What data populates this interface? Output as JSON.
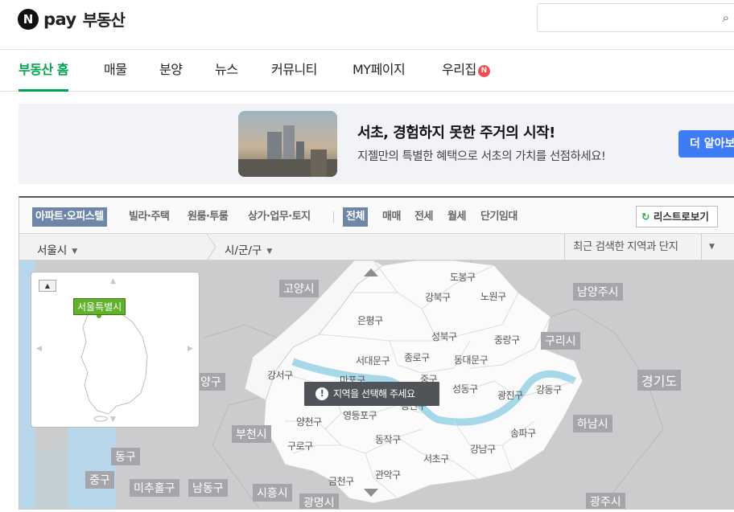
{
  "header": {
    "logo_n": "N",
    "logo_pay": "pay",
    "logo_title": "부동산",
    "search_placeholder": ""
  },
  "nav": {
    "tabs": [
      "부동산 홈",
      "매물",
      "분양",
      "뉴스",
      "커뮤니티",
      "MY페이지",
      "우리집"
    ],
    "badge": "N"
  },
  "promo": {
    "title": "서초, 경험하지 못한 주거의 시작!",
    "subtitle": "지젤만의 특별한 혜택으로 서초의 가치를 선점하세요!",
    "button": "더 알아보"
  },
  "filters": {
    "property_types": [
      "아파트·오피스텔",
      "빌라·주택",
      "원룸·투룸",
      "상가·업무·토지"
    ],
    "deal_types": [
      "전체",
      "매매",
      "전세",
      "월세",
      "단기임대"
    ],
    "list_view": "리스트로보기",
    "list_view_icon": "refresh-icon"
  },
  "selectors": {
    "city": "서울시",
    "district": "시/군/구",
    "recent": "최근 검색한 지역과 단지"
  },
  "map": {
    "mini_label": "서울특별시",
    "notice": "지역을 선택해 주세요",
    "districts": [
      "도봉구",
      "강북구",
      "노원구",
      "은평구",
      "성북구",
      "중랑구",
      "서대문구",
      "종로구",
      "동대문구",
      "강서구",
      "마포구",
      "중구",
      "성동구",
      "광진구",
      "강동구",
      "용산구",
      "양천구",
      "영등포구",
      "구로구",
      "동작구",
      "서초구",
      "강남구",
      "송파구",
      "관악구",
      "금천구"
    ],
    "outer": [
      "고양시",
      "남양주시",
      "구리시",
      "경기도",
      "하남시",
      "부천시",
      "동구",
      "중구",
      "미추홀구",
      "남동구",
      "시흥시",
      "광명시",
      "광주시",
      "양구"
    ]
  }
}
